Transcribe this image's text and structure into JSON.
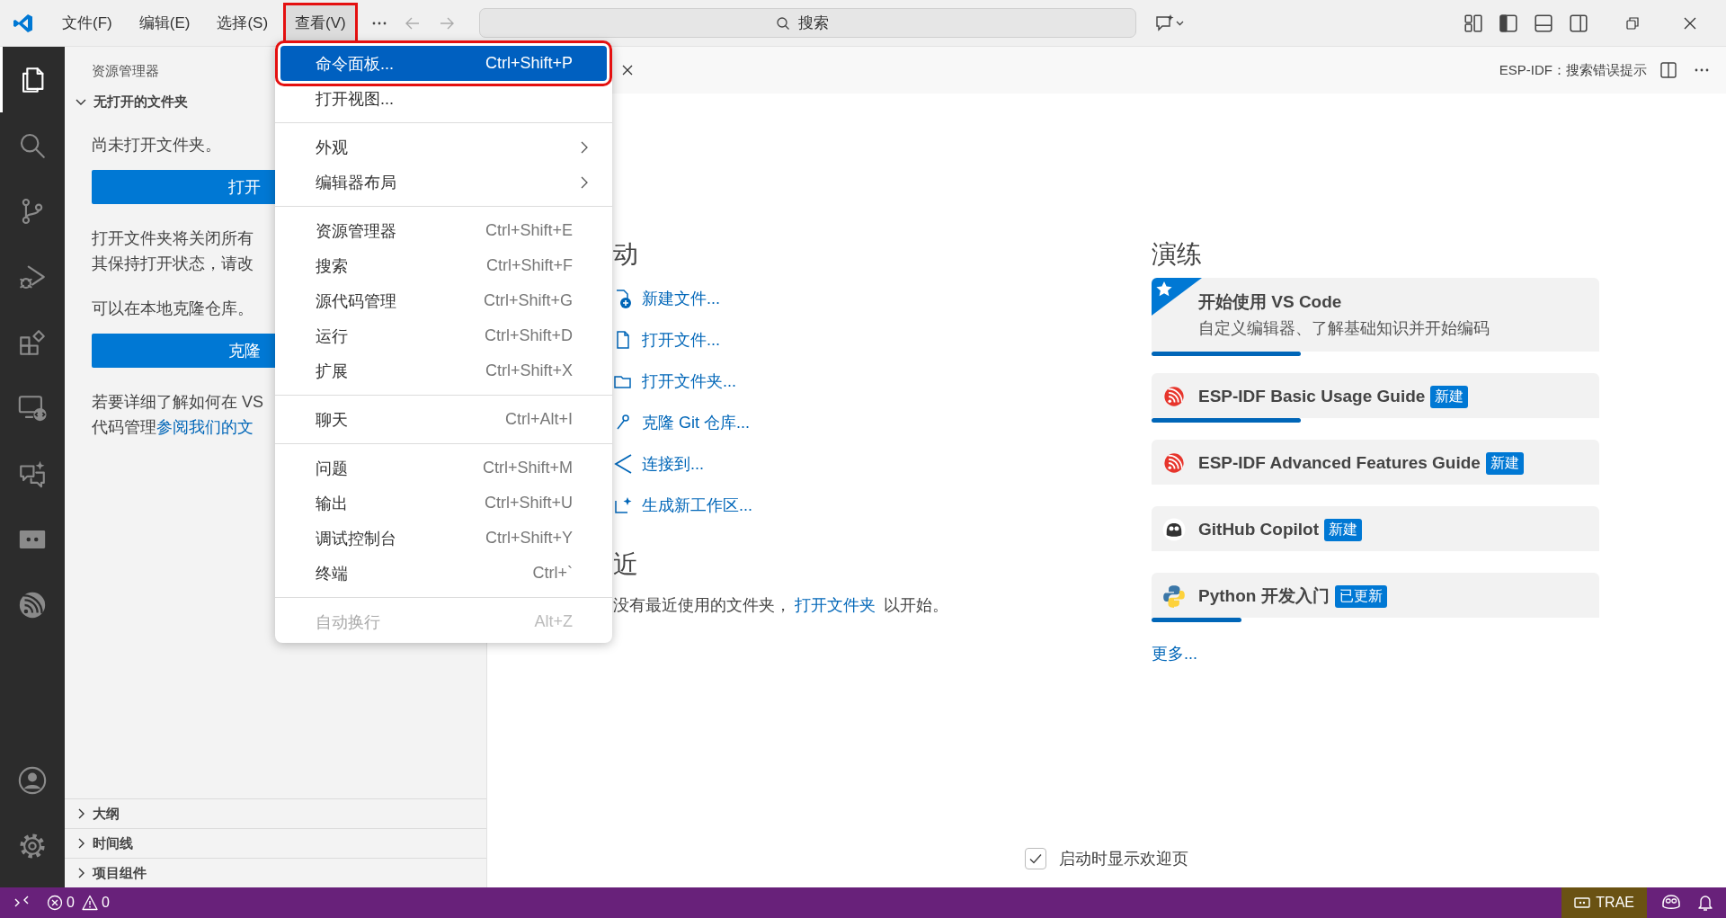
{
  "title_bar": {
    "menus": [
      {
        "label": "文件(F)",
        "selected": false,
        "annotated": false
      },
      {
        "label": "编辑(E)",
        "selected": false,
        "annotated": false
      },
      {
        "label": "选择(S)",
        "selected": false,
        "annotated": false
      },
      {
        "label": "查看(V)",
        "selected": true,
        "annotated": true
      }
    ],
    "search": {
      "placeholder": "搜索"
    }
  },
  "activity_bar": {
    "items": [
      {
        "kind": "explorer",
        "selected": true
      },
      {
        "kind": "search",
        "selected": false
      },
      {
        "kind": "scm",
        "selected": false
      },
      {
        "kind": "debug",
        "selected": false
      },
      {
        "kind": "extensions",
        "selected": false
      },
      {
        "kind": "remote",
        "selected": false
      },
      {
        "kind": "chat",
        "selected": false
      },
      {
        "kind": "board",
        "selected": false
      },
      {
        "kind": "esp",
        "selected": false
      }
    ],
    "bottom": [
      {
        "kind": "account",
        "selected": false
      },
      {
        "kind": "settings",
        "selected": false
      }
    ]
  },
  "sidebar": {
    "title": "资源管理器",
    "section": {
      "title": "无打开的文件夹",
      "expanded": true
    },
    "content": [
      {
        "kind": "text",
        "lines": [
          [
            {
              "kind": "plain",
              "text": "尚未打开文件夹。"
            }
          ]
        ]
      },
      {
        "kind": "button",
        "label": "打开"
      },
      {
        "kind": "text",
        "lines": [
          [
            {
              "kind": "plain",
              "text": "打开文件夹将关闭所有"
            }
          ],
          [
            {
              "kind": "plain",
              "text": "其保持打开状态，请改"
            }
          ]
        ]
      },
      {
        "kind": "text",
        "lines": [
          [
            {
              "kind": "plain",
              "text": "可以在本地克隆仓库。"
            }
          ]
        ]
      },
      {
        "kind": "button",
        "label": "克隆"
      },
      {
        "kind": "text",
        "lines": [
          [
            {
              "kind": "plain",
              "text": "若要详细了解如何在 VS"
            }
          ],
          [
            {
              "kind": "plain",
              "text": "代码管理"
            },
            {
              "kind": "link",
              "text": "参阅我们的文"
            }
          ]
        ]
      }
    ],
    "sections": [
      {
        "title": "大纲",
        "expanded": false
      },
      {
        "title": "时间线",
        "expanded": false
      },
      {
        "title": "项目组件",
        "expanded": false
      }
    ]
  },
  "view_menu": {
    "groups": [
      [
        {
          "label": "命令面板...",
          "shortcut": "Ctrl+Shift+P",
          "selected": true,
          "disabled": false,
          "submenu": false,
          "annotated": true
        },
        {
          "label": "打开视图...",
          "selected": false,
          "disabled": false,
          "submenu": false,
          "annotated": false
        }
      ],
      [
        {
          "label": "外观",
          "selected": false,
          "disabled": false,
          "submenu": true,
          "annotated": false
        },
        {
          "label": "编辑器布局",
          "selected": false,
          "disabled": false,
          "submenu": true,
          "annotated": false
        }
      ],
      [
        {
          "label": "资源管理器",
          "shortcut": "Ctrl+Shift+E",
          "selected": false,
          "disabled": false,
          "submenu": false,
          "annotated": false
        },
        {
          "label": "搜索",
          "shortcut": "Ctrl+Shift+F",
          "selected": false,
          "disabled": false,
          "submenu": false,
          "annotated": false
        },
        {
          "label": "源代码管理",
          "shortcut": "Ctrl+Shift+G",
          "selected": false,
          "disabled": false,
          "submenu": false,
          "annotated": false
        },
        {
          "label": "运行",
          "shortcut": "Ctrl+Shift+D",
          "selected": false,
          "disabled": false,
          "submenu": false,
          "annotated": false
        },
        {
          "label": "扩展",
          "shortcut": "Ctrl+Shift+X",
          "selected": false,
          "disabled": false,
          "submenu": false,
          "annotated": false
        }
      ],
      [
        {
          "label": "聊天",
          "shortcut": "Ctrl+Alt+I",
          "selected": false,
          "disabled": false,
          "submenu": false,
          "annotated": false
        }
      ],
      [
        {
          "label": "问题",
          "shortcut": "Ctrl+Shift+M",
          "selected": false,
          "disabled": false,
          "submenu": false,
          "annotated": false
        },
        {
          "label": "输出",
          "shortcut": "Ctrl+Shift+U",
          "selected": false,
          "disabled": false,
          "submenu": false,
          "annotated": false
        },
        {
          "label": "调试控制台",
          "shortcut": "Ctrl+Shift+Y",
          "selected": false,
          "disabled": false,
          "submenu": false,
          "annotated": false
        },
        {
          "label": "终端",
          "shortcut": "Ctrl+`",
          "selected": false,
          "disabled": false,
          "submenu": false,
          "annotated": false
        }
      ],
      [
        {
          "label": "自动换行",
          "shortcut": "Alt+Z",
          "selected": false,
          "disabled": true,
          "submenu": false,
          "annotated": false
        }
      ]
    ]
  },
  "editor": {
    "action_label": "ESP-IDF：搜索错误提示",
    "welcome": {
      "start": {
        "title": "动",
        "items": [
          {
            "kind": "new-file",
            "label": "新建文件..."
          },
          {
            "kind": "open-file",
            "label": "打开文件..."
          },
          {
            "kind": "open-folder",
            "label": "打开文件夹..."
          },
          {
            "kind": "clone",
            "label": "克隆 Git 仓库..."
          },
          {
            "kind": "connect",
            "label": "连接到..."
          },
          {
            "kind": "new-workspace",
            "label": "生成新工作区..."
          }
        ]
      },
      "recent": {
        "title": "近",
        "text": "没有最近使用的文件夹，",
        "link": "打开文件夹",
        "suffix": " 以开始。"
      },
      "walkthroughs": {
        "title": "演练",
        "items": [
          {
            "kind": "star",
            "title": "开始使用 VS Code",
            "description": "自定义编辑器、了解基础知识并开始编码",
            "level": 0.333
          },
          {
            "kind": "esp",
            "title": "ESP-IDF Basic Usage Guide",
            "badge": "新建",
            "level": 0.333
          },
          {
            "kind": "esp",
            "title": "ESP-IDF Advanced Features Guide",
            "badge": "新建"
          },
          {
            "kind": "copilot",
            "title": "GitHub Copilot",
            "badge": "新建"
          },
          {
            "kind": "python",
            "title": "Python 开发入门",
            "badge": "已更新",
            "level": 0.2
          }
        ],
        "more": "更多..."
      },
      "show_on_startup": {
        "label": "启动时显示欢迎页",
        "checked": true
      }
    }
  },
  "status_bar": {
    "errors": "0",
    "warnings": "0",
    "trae": "TRAE"
  }
}
